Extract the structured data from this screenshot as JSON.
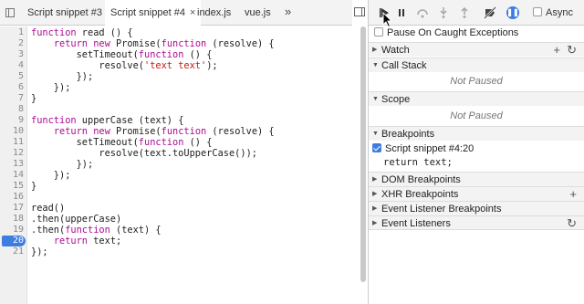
{
  "tabs": [
    {
      "label": "Script snippet #3",
      "active": false
    },
    {
      "label": "Script snippet #4",
      "active": true,
      "close": "×"
    },
    {
      "label": "index.js",
      "active": false
    },
    {
      "label": "vue.js",
      "active": false
    }
  ],
  "more_tabs": "»",
  "code": {
    "line_numbers": [
      "1",
      "2",
      "3",
      "4",
      "5",
      "6",
      "7",
      "8",
      "9",
      "10",
      "11",
      "12",
      "13",
      "14",
      "15",
      "16",
      "17",
      "18",
      "19",
      "20",
      "21"
    ],
    "breakpoint_line": "20"
  },
  "debugger": {
    "async_label": "Async",
    "pause_on_caught_label": "Pause On Caught Exceptions",
    "sections": {
      "watch": "Watch",
      "call_stack": "Call Stack",
      "call_stack_empty": "Not Paused",
      "scope": "Scope",
      "scope_empty": "Not Paused",
      "breakpoints": "Breakpoints",
      "breakpoint_location": "Script snippet #4:20",
      "breakpoint_code": "return text;",
      "dom_breakpoints": "DOM Breakpoints",
      "xhr_breakpoints": "XHR Breakpoints",
      "event_listener_breakpoints": "Event Listener Breakpoints",
      "event_listeners": "Event Listeners"
    },
    "icons": {
      "add": "+",
      "refresh": "↻"
    }
  },
  "colors": {
    "keyword": "#aa0d91",
    "string": "#c41a16",
    "accent": "#3e7de0"
  }
}
